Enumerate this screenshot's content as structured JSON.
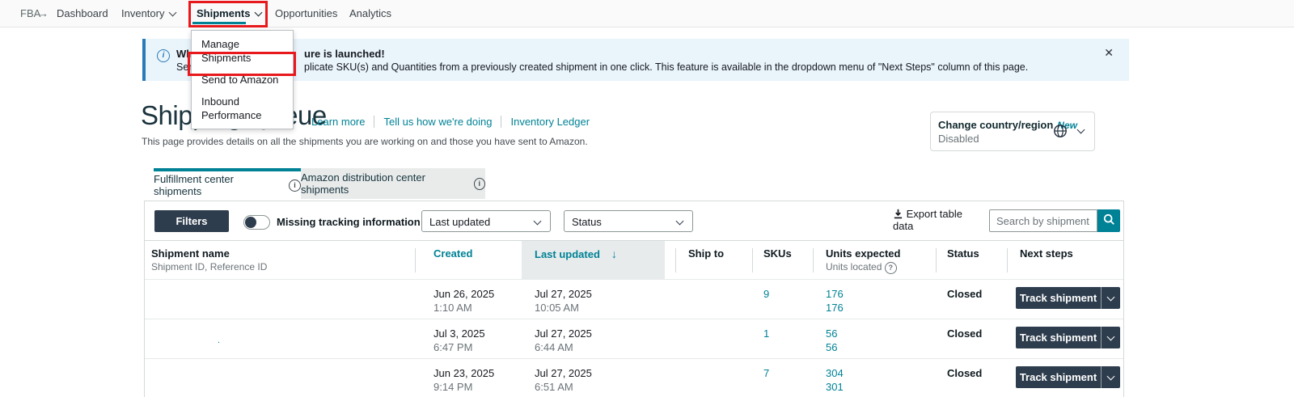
{
  "nav": {
    "brand": "FBA",
    "arrow_glyph": "→",
    "items": [
      "Dashboard",
      "Inventory",
      "Shipments",
      "Opportunities",
      "Analytics"
    ]
  },
  "shipments_menu": {
    "items": [
      "Manage Shipments",
      "Send to Amazon",
      "Inbound Performance"
    ]
  },
  "banner": {
    "line1_prefix": "What",
    "line1_suffix": "ure is launched!",
    "line2_prefix": "Send",
    "line2_suffix": "plicate SKU(s) and Quantities from a previously created shipment in one click. This feature is available in the dropdown menu of \"Next Steps\" column of this page.",
    "close_glyph": "✕"
  },
  "page_header": {
    "title": "Shipping Queue",
    "links": [
      "Learn more",
      "Tell us how we're doing",
      "Inventory Ledger"
    ],
    "subtitle": "This page provides details on all the shipments you are working on and those you have sent to Amazon."
  },
  "country_widget": {
    "label": "Change country/region",
    "badge": "New",
    "status": "Disabled"
  },
  "tabs": [
    {
      "label": "Fulfillment center shipments"
    },
    {
      "label": "Amazon distribution center shipments"
    }
  ],
  "toolbar": {
    "filters_label": "Filters",
    "toggle_label": "Missing tracking information only",
    "toggle_on": false,
    "sort_select_value": "Last updated",
    "status_select_value": "Status",
    "export_label": " Export table data",
    "search_placeholder": "Search by shipment ID"
  },
  "table": {
    "headers": {
      "shipment_name": "Shipment name",
      "shipment_name_sub": "Shipment ID, Reference ID",
      "created": "Created",
      "last_updated": "Last updated",
      "sort_arrow": "↓",
      "ship_to": "Ship to",
      "skus": "SKUs",
      "units_expected": "Units expected",
      "units_located_sub": "Units located",
      "status": "Status",
      "next_steps": "Next steps"
    },
    "rows": [
      {
        "created_date": "Jun 26, 2025",
        "created_time": "1:10 AM",
        "updated_date": "Jul 27, 2025",
        "updated_time": "10:05 AM",
        "skus": "9",
        "units_expected": "176",
        "units_located": "176",
        "status": "Closed",
        "action_label": "Track shipment"
      },
      {
        "name_fragment": ".",
        "created_date": "Jul 3, 2025",
        "created_time": "6:47 PM",
        "updated_date": "Jul 27, 2025",
        "updated_time": "6:44 AM",
        "skus": "1",
        "units_expected": "56",
        "units_located": "56",
        "status": "Closed",
        "action_label": "Track shipment"
      },
      {
        "created_date": "Jun 23, 2025",
        "created_time": "9:14 PM",
        "updated_date": "Jul 27, 2025",
        "updated_time": "6:51 AM",
        "skus": "7",
        "units_expected": "304",
        "units_located": "301",
        "status": "Closed",
        "action_label": "Track shipment"
      }
    ]
  },
  "icons": {
    "info_glyph": "i",
    "question_glyph": "?"
  },
  "colors": {
    "accent_teal": "#008296",
    "dark_button": "#2e3d4d",
    "annotation_red": "#e8191c",
    "banner_blue": "#2a7ab9",
    "banner_bg": "#e9f4fb",
    "sorted_column_bg": "#e7ebeb"
  }
}
